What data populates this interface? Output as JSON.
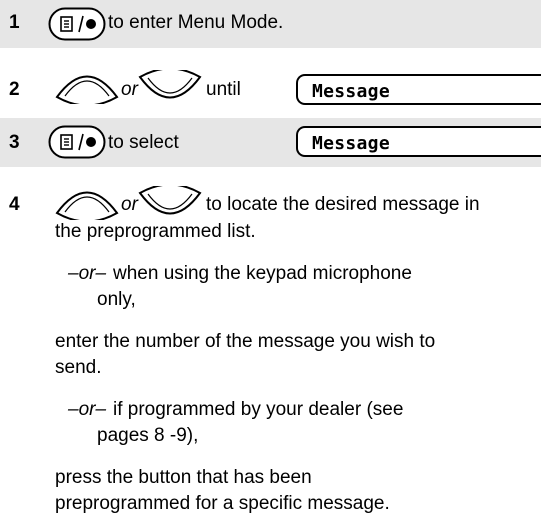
{
  "steps": [
    {
      "number": "1",
      "text": "to enter Menu Mode."
    },
    {
      "number": "2",
      "or": "or",
      "text": "until",
      "display": "Message"
    },
    {
      "number": "3",
      "text": "to select",
      "display": "Message"
    },
    {
      "number": "4",
      "or": "or",
      "line1": "to locate the desired message in",
      "line2": "the preprogrammed list.",
      "alt1_or": "–or–",
      "alt1_line1": "when using the keypad microphone",
      "alt1_line2": "only,",
      "p2_line1": "enter the number of the message you wish to",
      "p2_line2": "send.",
      "alt2_or": "–or–",
      "alt2_line1": "if programmed by your dealer (see",
      "alt2_line2": "pages 8 -9),",
      "p3_line1": "press the button that has been",
      "p3_line2": "preprogrammed for a specific message."
    }
  ],
  "colors": {
    "band": "#e6e6e6"
  },
  "icons": [
    "menu-select-button-icon",
    "up-arrow-button-icon",
    "down-arrow-button-icon"
  ]
}
